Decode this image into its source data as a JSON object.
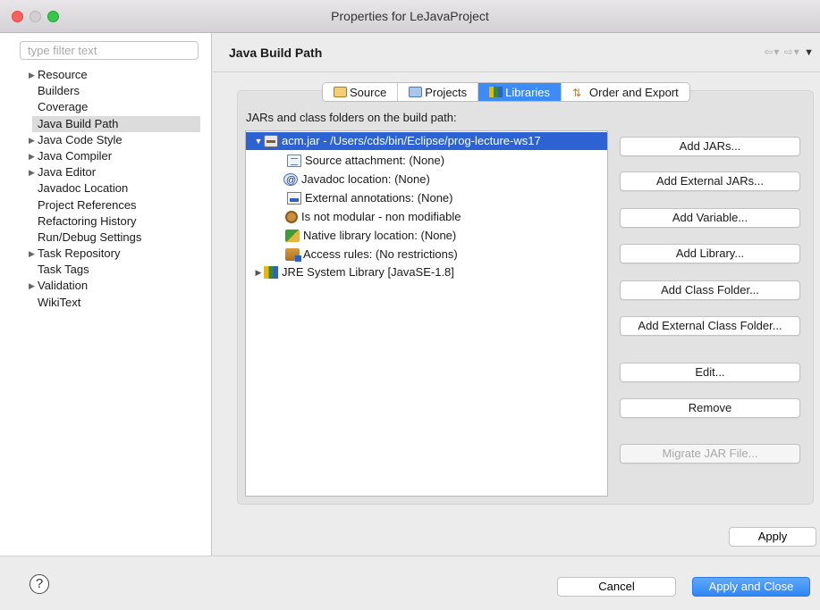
{
  "window": {
    "title": "Properties for LeJavaProject"
  },
  "sidebar": {
    "filter_placeholder": "type filter text",
    "items": [
      {
        "label": "Resource",
        "expandable": true
      },
      {
        "label": "Builders",
        "expandable": false
      },
      {
        "label": "Coverage",
        "expandable": false
      },
      {
        "label": "Java Build Path",
        "expandable": false,
        "selected": true
      },
      {
        "label": "Java Code Style",
        "expandable": true
      },
      {
        "label": "Java Compiler",
        "expandable": true
      },
      {
        "label": "Java Editor",
        "expandable": true
      },
      {
        "label": "Javadoc Location",
        "expandable": false
      },
      {
        "label": "Project References",
        "expandable": false
      },
      {
        "label": "Refactoring History",
        "expandable": false
      },
      {
        "label": "Run/Debug Settings",
        "expandable": false
      },
      {
        "label": "Task Repository",
        "expandable": true
      },
      {
        "label": "Task Tags",
        "expandable": false
      },
      {
        "label": "Validation",
        "expandable": true
      },
      {
        "label": "WikiText",
        "expandable": false
      }
    ]
  },
  "main": {
    "title": "Java Build Path",
    "tabs": [
      {
        "label": "Source",
        "icon": "source-folder-icon"
      },
      {
        "label": "Projects",
        "icon": "projects-folder-icon"
      },
      {
        "label": "Libraries",
        "icon": "libraries-icon",
        "active": true
      },
      {
        "label": "Order and Export",
        "icon": "order-export-icon"
      }
    ],
    "list_label": "JARs and class folders on the build path:",
    "tree": [
      {
        "label": "acm.jar - /Users/cds/bin/Eclipse/prog-lecture-ws17",
        "icon": "jar-icon",
        "expanded": true,
        "selected": true,
        "level": 0
      },
      {
        "label": "Source attachment: (None)",
        "icon": "source-attachment-icon",
        "level": 1
      },
      {
        "label": "Javadoc location: (None)",
        "icon": "javadoc-icon",
        "level": 1
      },
      {
        "label": "External annotations: (None)",
        "icon": "annotations-icon",
        "level": 1
      },
      {
        "label": "Is not modular - non modifiable",
        "icon": "module-gear-icon",
        "level": 1
      },
      {
        "label": "Native library location: (None)",
        "icon": "native-library-icon",
        "level": 1
      },
      {
        "label": "Access rules: (No restrictions)",
        "icon": "access-rules-icon",
        "level": 1
      },
      {
        "label": "JRE System Library [JavaSE-1.8]",
        "icon": "jre-library-icon",
        "expanded": false,
        "level": 0
      }
    ],
    "buttons": {
      "add_jars": "Add JARs...",
      "add_external_jars": "Add External JARs...",
      "add_variable": "Add Variable...",
      "add_library": "Add Library...",
      "add_class_folder": "Add Class Folder...",
      "add_external_class_folder": "Add External Class Folder...",
      "edit": "Edit...",
      "remove": "Remove",
      "migrate_jar": "Migrate JAR File..."
    },
    "apply": "Apply"
  },
  "footer": {
    "help": "?",
    "cancel": "Cancel",
    "apply_close": "Apply and Close"
  }
}
